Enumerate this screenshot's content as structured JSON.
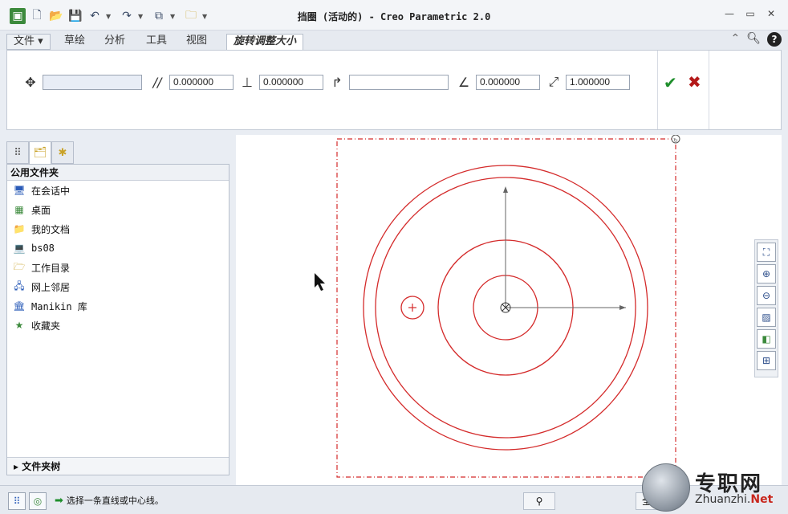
{
  "window": {
    "title": "挡圈 (活动的) - Creo Parametric 2.0",
    "controls": [
      "—",
      "▭",
      "✕"
    ]
  },
  "quick_access": [
    "app-icon",
    "new-icon",
    "open-icon",
    "save-icon",
    "undo-icon",
    "redo-icon",
    "window-icon",
    "close-window-icon",
    "customize-icon"
  ],
  "ribbon": {
    "tabs": [
      {
        "label": "文件 ▾"
      },
      {
        "label": "草绘"
      },
      {
        "label": "分析"
      },
      {
        "label": "工具"
      },
      {
        "label": "视图"
      },
      {
        "label": "旋转调整大小"
      }
    ],
    "active_tab": "旋转调整大小"
  },
  "dashboard": {
    "move_value": "",
    "horizontal_value": "0.000000",
    "vertical_value": "0.000000",
    "reference_value": "",
    "rotate_value": "0.000000",
    "scale_value": "1.000000"
  },
  "navigator": {
    "header": "公用文件夹",
    "items": [
      {
        "label": "在会话中",
        "icon": "session-icon"
      },
      {
        "label": "桌面",
        "icon": "desktop-icon"
      },
      {
        "label": "我的文档",
        "icon": "documents-icon"
      },
      {
        "label": "bs08",
        "icon": "computer-icon"
      },
      {
        "label": "工作目录",
        "icon": "working-dir-icon"
      },
      {
        "label": "网上邻居",
        "icon": "network-icon"
      },
      {
        "label": "Manikin 库",
        "icon": "library-icon"
      },
      {
        "label": "收藏夹",
        "icon": "favorites-icon"
      }
    ],
    "footer": "▸ 文件夹树"
  },
  "status": {
    "message": "选择一条直线或中心线。",
    "filter": "全"
  },
  "watermark": {
    "title": "专职网",
    "url_prefix": "Zhuanzhi.",
    "url_suffix": "Net"
  },
  "colors": {
    "sketch": "#d42b2b",
    "axis": "#666666",
    "accent_ok": "#1e8e2b",
    "accent_cancel": "#b41a1a"
  }
}
